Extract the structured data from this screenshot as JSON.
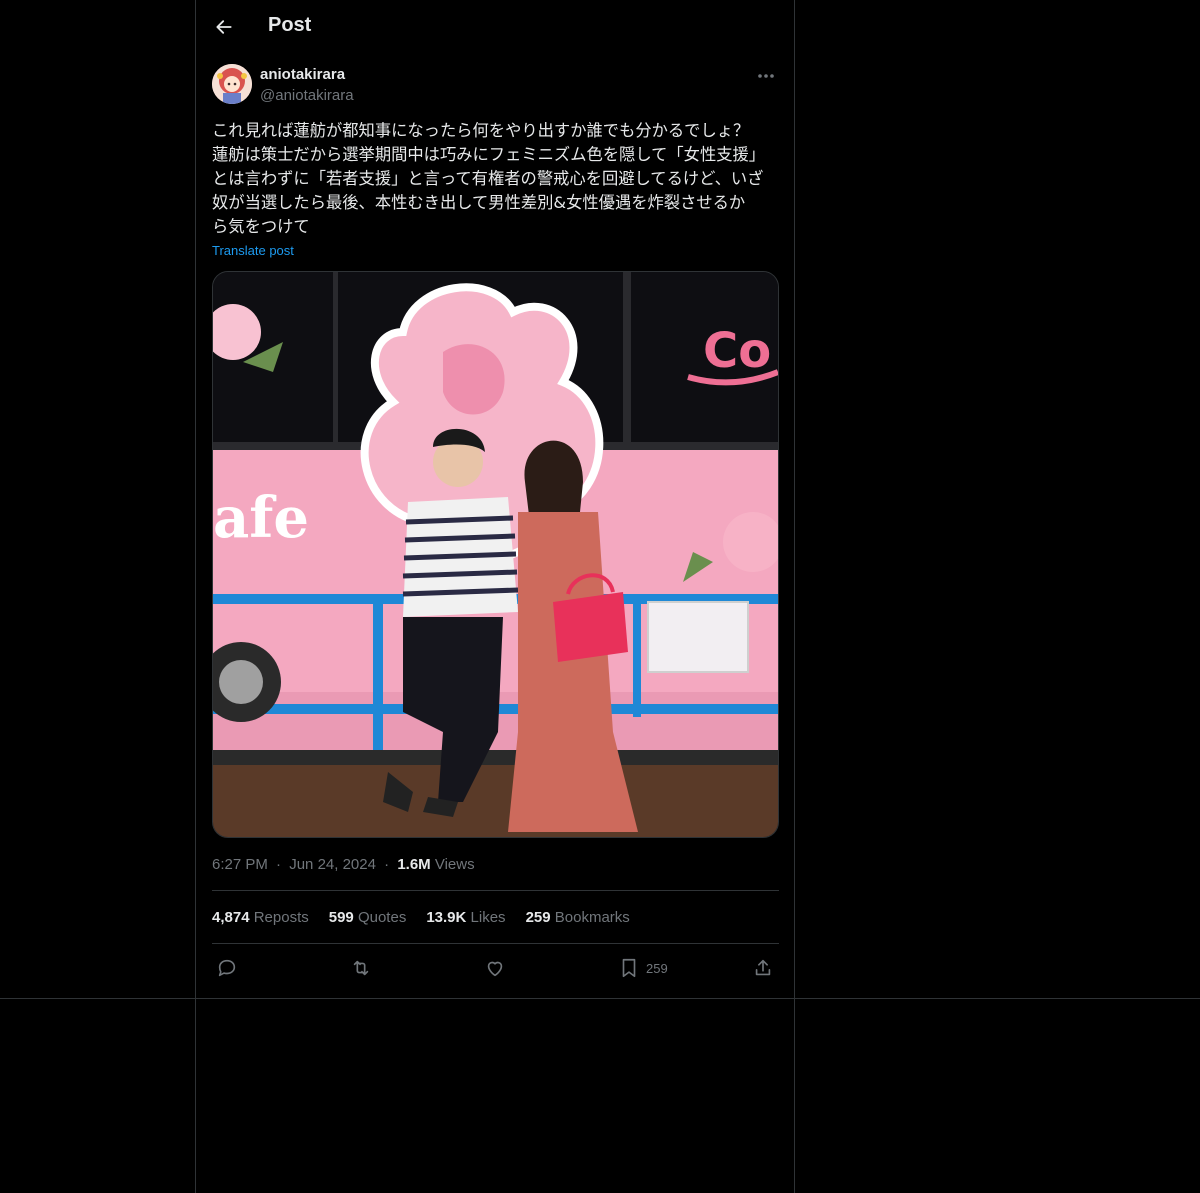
{
  "header": {
    "back_icon": "arrow-left-icon",
    "title": "Post"
  },
  "author": {
    "display_name": "aniotakirara",
    "handle": "@aniotakirara",
    "more_icon": "more-horizontal-icon"
  },
  "tweet": {
    "text": "これ見れば蓮舫が都知事になったら何をやり出すか誰でも分かるでしょ？\n蓮舫は策士だから選挙期間中は巧みにフェミニズム色を隠して「女性支援」\nとは言わずに「若者支援」と言って有権者の警戒心を回避してるけど、いざ\n奴が当選したら最後、本性むき出して男性差別&女性優遇を炸裂させるか\nら気をつけて",
    "translate_label": "Translate post"
  },
  "meta": {
    "time": "6:27 PM",
    "separator": "·",
    "date": "Jun 24, 2024",
    "views_count": "1.6M",
    "views_label": "Views"
  },
  "stats": {
    "reposts_count": "4,874",
    "reposts_label": "Reposts",
    "quotes_count": "599",
    "quotes_label": "Quotes",
    "likes_count": "13.9K",
    "likes_label": "Likes",
    "bookmarks_count": "259",
    "bookmarks_label": "Bookmarks"
  },
  "actions": {
    "reply_icon": "reply-icon",
    "repost_icon": "repost-icon",
    "like_icon": "heart-icon",
    "bookmark_icon": "bookmark-icon",
    "bookmark_count": "259",
    "share_icon": "share-icon"
  },
  "colors": {
    "background": "#000000",
    "border": "#2f3336",
    "text_primary": "#e7e9ea",
    "text_secondary": "#71767b",
    "accent": "#1d9bf0"
  }
}
